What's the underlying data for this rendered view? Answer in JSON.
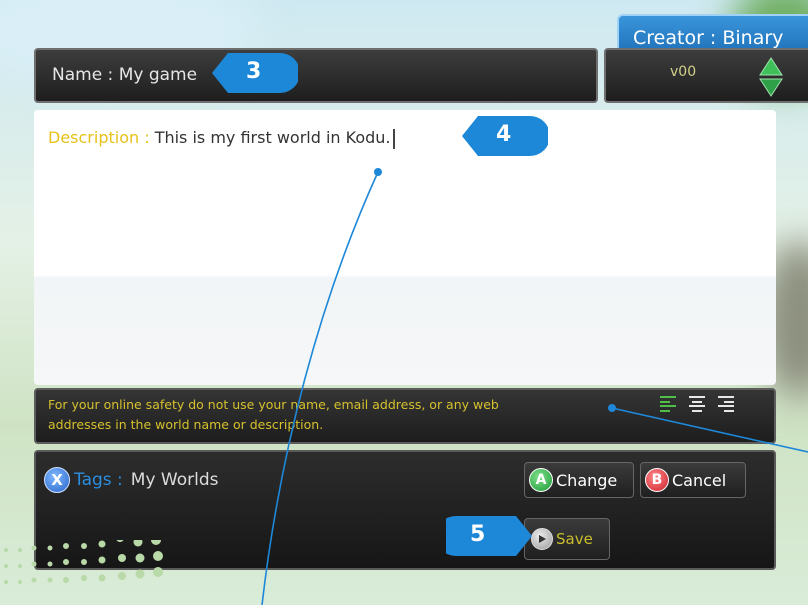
{
  "header": {
    "creator_label": "Creator : Binary"
  },
  "name_field": {
    "text": "Name : My game"
  },
  "version": {
    "text": "v00"
  },
  "description": {
    "label": "Description : ",
    "value": "This is my first world in Kodu."
  },
  "safety_notice": {
    "line1": "For your online safety do not use your name, email address, or any web",
    "line2": "addresses in the world name or description."
  },
  "align_icons": [
    "align-left-icon",
    "align-center-icon",
    "align-right-icon"
  ],
  "tags": {
    "button": "X",
    "label": "Tags : ",
    "value": "My Worlds"
  },
  "buttons": {
    "change": {
      "key": "A",
      "label": "Change"
    },
    "cancel": {
      "key": "B",
      "label": "Cancel"
    },
    "save": {
      "label": "Save"
    }
  },
  "callouts": [
    "3",
    "4",
    "5"
  ],
  "colors": {
    "accent_blue": "#1e7fd6",
    "callout_blue": "#1e88d8",
    "label_yellow": "#e6c21a",
    "a_green": "#1c9a36",
    "b_red": "#cc1f2a"
  }
}
